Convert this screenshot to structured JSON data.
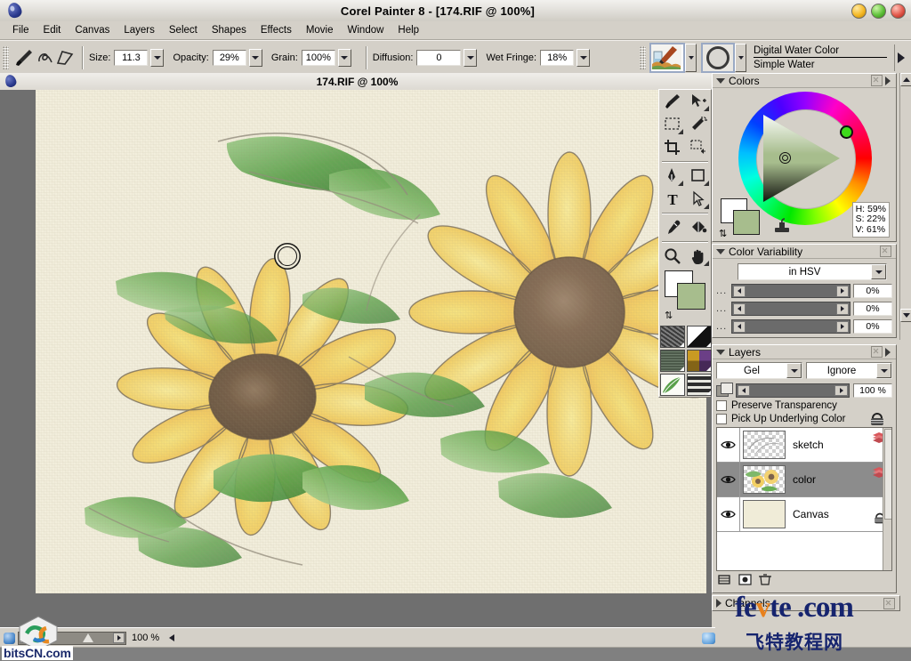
{
  "window": {
    "title": "Corel Painter 8 - [174.RIF @ 100%]",
    "logo_icon": "painter-drop-logo",
    "buttons": [
      {
        "name": "minimize",
        "color": "#f5b824"
      },
      {
        "name": "maximize",
        "color": "#5fc13a"
      },
      {
        "name": "close",
        "color": "#e2574a"
      }
    ]
  },
  "menubar": {
    "items": [
      "File",
      "Edit",
      "Canvas",
      "Layers",
      "Select",
      "Shapes",
      "Effects",
      "Movie",
      "Window",
      "Help"
    ]
  },
  "propertybar": {
    "brush_tool_icon": "brush-icon",
    "stroke_preview_icon": "stroke-preview-icon",
    "fields": [
      {
        "label": "Size:",
        "value": "11.3"
      },
      {
        "label": "Opacity:",
        "value": "29%"
      },
      {
        "label": "Grain:",
        "value": "100%"
      },
      {
        "label": "Diffusion:",
        "value": "0"
      },
      {
        "label": "Wet Fringe:",
        "value": "18%"
      }
    ],
    "brush_category": "Digital Water Color",
    "brush_variant": "Simple Water",
    "category_icon": "brush-jar-icon",
    "variant_icon": "ring-dab-icon",
    "expand_icon": "right-arrow-icon"
  },
  "document": {
    "title": "174.RIF @ 100%",
    "logo_icon": "painter-drop-logo-small",
    "close_icon": "red-close-dot"
  },
  "toolbox": {
    "tools": [
      {
        "name": "brush-tool",
        "icon": "brush-icon"
      },
      {
        "name": "layer-adjuster-tool",
        "icon": "arrow-move-icon"
      },
      {
        "name": "rectangular-selection-tool",
        "icon": "marquee-icon"
      },
      {
        "name": "magic-wand-tool",
        "icon": "magic-wand-icon"
      },
      {
        "name": "crop-tool",
        "icon": "crop-icon"
      },
      {
        "name": "selection-adjuster-tool",
        "icon": "selection-move-icon"
      },
      {
        "name": "pen-tool",
        "icon": "pen-nib-icon"
      },
      {
        "name": "rectangular-shape-tool",
        "icon": "rectangle-icon"
      },
      {
        "name": "text-tool",
        "icon": "text-T-icon"
      },
      {
        "name": "shape-selection-tool",
        "icon": "arrow-pointer-icon"
      },
      {
        "name": "dropper-tool",
        "icon": "eyedropper-icon"
      },
      {
        "name": "paint-bucket-tool",
        "icon": "paint-bucket-icon"
      },
      {
        "name": "magnifier-tool",
        "icon": "magnifier-icon"
      },
      {
        "name": "grabber-tool",
        "icon": "hand-icon"
      }
    ],
    "color_swatches": {
      "main_color": "#ffffff",
      "additional_color": "#a7bd8d",
      "swap_icon": "swap-colors-icon"
    },
    "selectors": [
      {
        "name": "paper-selector",
        "icon": "paper-texture-swatch"
      },
      {
        "name": "gradient-selector",
        "icon": "gradient-swatch"
      },
      {
        "name": "pattern-selector",
        "icon": "pattern-swatch"
      },
      {
        "name": "weave-selector",
        "icon": "weave-swatch"
      },
      {
        "name": "nozzle-selector",
        "icon": "nozzle-swatch"
      },
      {
        "name": "look-selector",
        "icon": "look-swatch"
      }
    ]
  },
  "colors_palette": {
    "title": "Colors",
    "collapse_icon": "triangle-down-icon",
    "close_icon": "close-box-icon",
    "menu_icon": "triangle-right-icon",
    "hue_readout": "H: 59%",
    "sat_readout": "S: 22%",
    "val_readout": "V: 61%",
    "main_color": "#ffffff",
    "additional_color": "#a7bd8d",
    "clone_icon": "clone-color-icon",
    "swap_icon": "swap-colors-icon",
    "hue_ring_icon": "hue-ring",
    "sv_triangle_icon": "saturation-value-triangle"
  },
  "color_variability": {
    "title": "Color Variability",
    "collapse_icon": "triangle-down-icon",
    "close_icon": "close-box-icon",
    "model": "in HSV",
    "sliders": [
      {
        "name": "hue-variability",
        "dots": "...",
        "value": "0%"
      },
      {
        "name": "saturation-variability",
        "dots": "...",
        "value": "0%"
      },
      {
        "name": "value-variability",
        "dots": "...",
        "value": "0%"
      }
    ]
  },
  "layers_palette": {
    "title": "Layers",
    "collapse_icon": "triangle-down-icon",
    "close_icon": "close-box-icon",
    "menu_icon": "triangle-right-icon",
    "composite_method": "Gel",
    "composite_depth": "Ignore",
    "opacity": "100 %",
    "opacity_icon": "layer-opacity-icon",
    "checkboxes": [
      {
        "name": "preserve-transparency",
        "label": "Preserve Transparency",
        "checked": false
      },
      {
        "name": "pick-up-underlying-color",
        "label": "Pick Up Underlying Color",
        "checked": false
      }
    ],
    "lock_icon": "lock-icon",
    "layers": [
      {
        "name": "sketch",
        "visible": true,
        "selected": false,
        "thumb": "transparent-sketch-thumb"
      },
      {
        "name": "color",
        "visible": true,
        "selected": true,
        "thumb": "sunflower-color-thumb"
      },
      {
        "name": "Canvas",
        "visible": true,
        "selected": false,
        "thumb": "paper-canvas-thumb",
        "locked": true
      }
    ],
    "footer_icons": [
      "new-layer-icon",
      "layer-mask-icon",
      "delete-layer-icon"
    ],
    "channels_label": "Channels",
    "channels_expand_icon": "triangle-right-icon"
  },
  "statusbar": {
    "zoom_value": "100 %",
    "zoom_slider_icon": "zoom-slider",
    "left_blob_icon": "status-blob-icon",
    "message": "",
    "message_arrow_icon": "left-arrow-icon",
    "right_blob_icon": "memory-blob-icon"
  },
  "watermarks": {
    "bits": "bitsCN.com",
    "fevte_pre": "fe",
    "fevte_o": "v",
    "fevte_post": "te .com",
    "fevte_cn": "飞特教程网"
  }
}
